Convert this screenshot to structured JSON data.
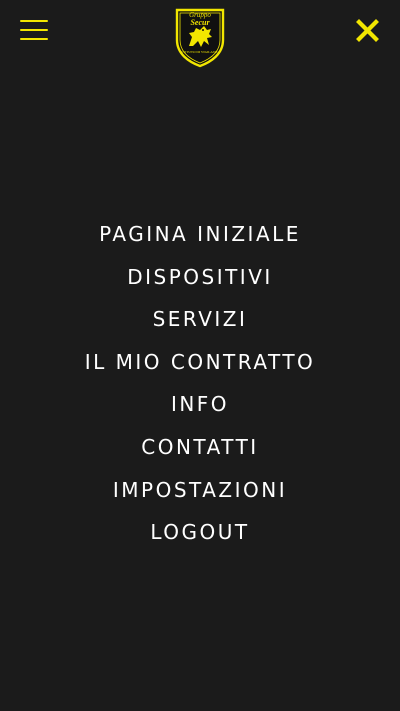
{
  "header": {
    "menu_icon": "hamburger-menu-icon",
    "close_icon": "close-x-icon",
    "logo": {
      "line1": "Gruppo",
      "line2": "Secur",
      "line3": "ISTITUTO DI VIGILANZA"
    }
  },
  "colors": {
    "background": "#1b1b1b",
    "accent": "#f2e600",
    "menu_text": "#ffffff"
  },
  "menu": {
    "items": [
      "PAGINA INIZIALE",
      "DISPOSITIVI",
      "SERVIZI",
      "IL MIO CONTRATTO",
      "INFO",
      "CONTATTI",
      "IMPOSTAZIONI",
      "LOGOUT"
    ]
  }
}
